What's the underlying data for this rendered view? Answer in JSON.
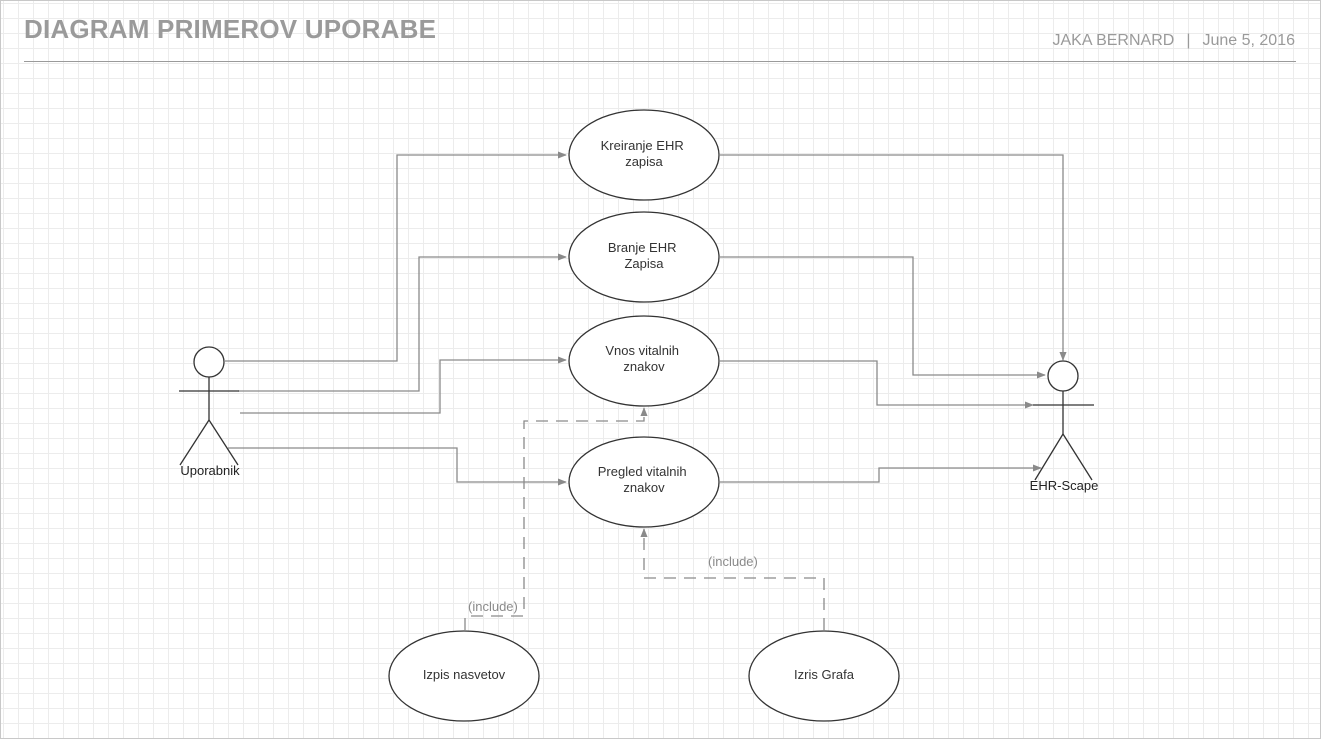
{
  "header": {
    "title": "DIAGRAM PRIMEROV UPORABE",
    "author": "JAKA BERNARD",
    "separator": "|",
    "date": "June 5, 2016"
  },
  "actors": {
    "user": "Uporabnik",
    "system": "EHR-Scape"
  },
  "use_cases": {
    "create_ehr": [
      "Kreiranje EHR",
      "zapisa"
    ],
    "read_ehr": [
      "Branje EHR",
      "Zapisa"
    ],
    "enter_vitals": [
      "Vnos vitalnih",
      "znakov"
    ],
    "view_vitals": [
      "Pregled vitalnih",
      "znakov"
    ],
    "print_advice": [
      "Izpis nasvetov"
    ],
    "draw_graph": [
      "Izris Grafa"
    ]
  },
  "relations": {
    "include_left": "(include)",
    "include_right": "(include)"
  },
  "colors": {
    "line": "#8a8a8a",
    "shape_stroke": "#333333",
    "header_text": "#9a9a9a"
  }
}
